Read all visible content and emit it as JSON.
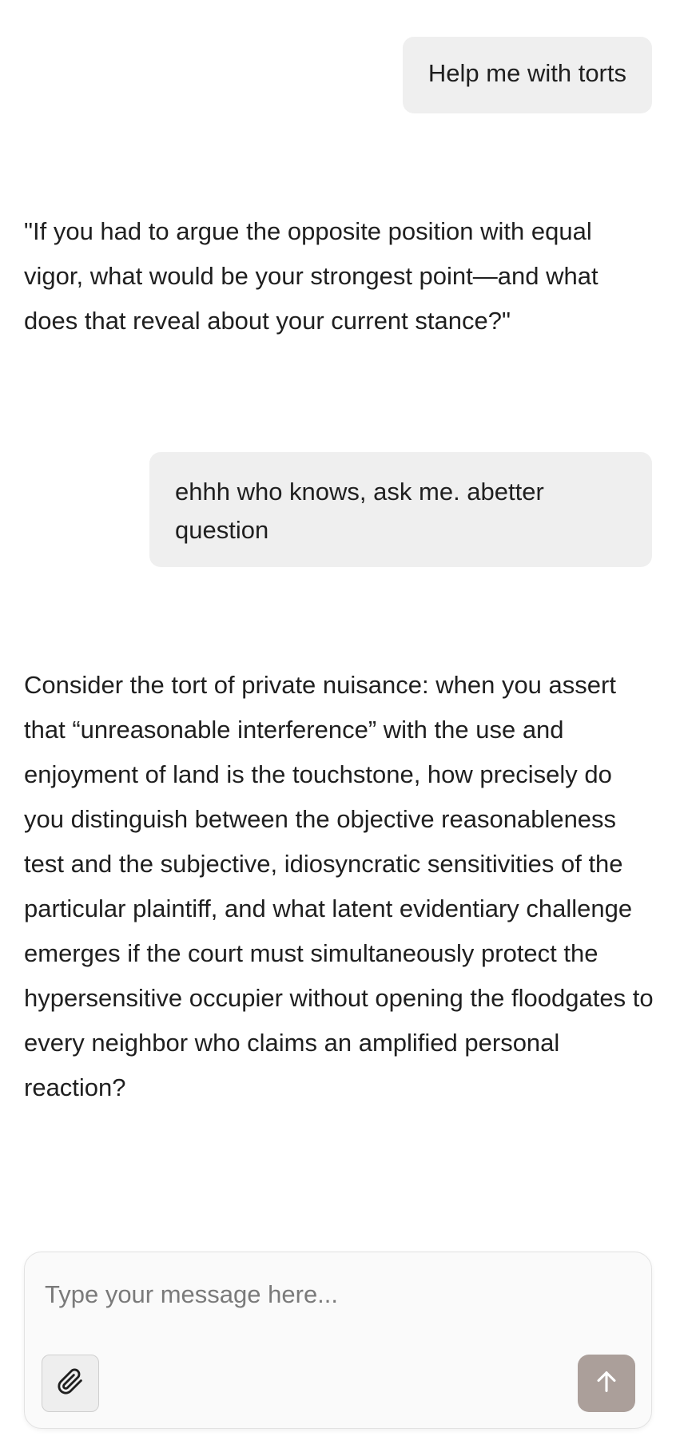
{
  "messages": {
    "user_1": "Help me with torts",
    "assistant_1": "\"If you had to argue the opposite position with equal vigor, what would be your strongest point—and what does that reveal about your current stance?\"",
    "user_2": "ehhh who knows, ask me. abetter question",
    "assistant_2": "Consider the tort of private nuisance: when you assert that “unreasonable interference” with the use and enjoyment of land is the touchstone, how precisely do you distinguish between the objective reasonableness test and the subjective, idiosyncratic sensitivities of the particular plaintiff, and what latent evidentiary challenge emerges if the court must simultaneously protect the hypersensitive occupier without opening the floodgates to every neighbor who claims an amplified personal reaction?"
  },
  "composer": {
    "placeholder": "Type your message here...",
    "value": "",
    "attach_icon": "paperclip-icon",
    "send_icon": "arrow-up-icon",
    "send_color": "#ab9f9a"
  },
  "colors": {
    "user_bubble_bg": "#efefef",
    "text": "#1f1f1f",
    "composer_bg": "#fafafa"
  }
}
